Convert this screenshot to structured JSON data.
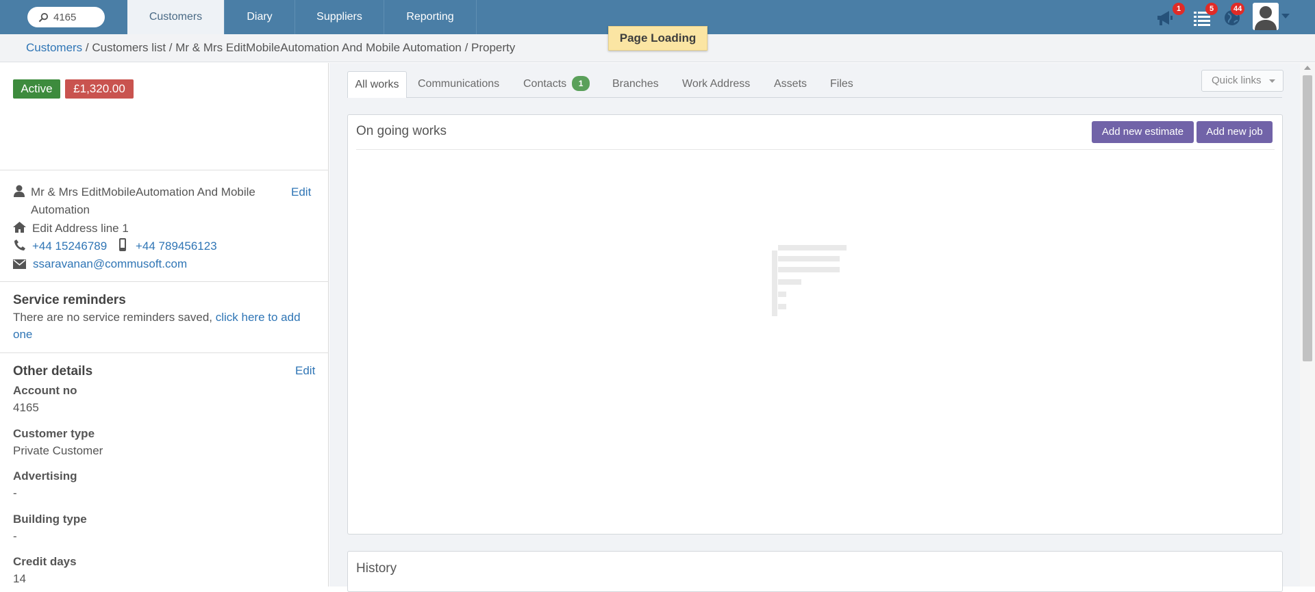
{
  "search": {
    "value": "4165"
  },
  "nav": {
    "tabs": [
      {
        "label": "Customers",
        "active": true
      },
      {
        "label": "Diary"
      },
      {
        "label": "Suppliers"
      },
      {
        "label": "Reporting"
      }
    ]
  },
  "notifications": {
    "announcements": "1",
    "tasks": "5",
    "online": "44"
  },
  "breadcrumb": {
    "root": "Customers",
    "rest": " / Customers list / Mr & Mrs EditMobileAutomation And Mobile Automation / Property"
  },
  "loading_toast": "Page Loading",
  "customer": {
    "status": "Active",
    "balance": "£1,320.00",
    "name_line1": "Mr & Mrs EditMobileAutomation And Mobile",
    "name_line2": "Automation",
    "edit_label": "Edit",
    "address": "Edit Address line 1",
    "phone": "+44 15246789",
    "mobile": "+44 789456123",
    "email": "ssaravanan@commusoft.com"
  },
  "service_reminders": {
    "title": "Service reminders",
    "text": "There are no service reminders saved, ",
    "link_part1": "click here to add",
    "link_part2": "one"
  },
  "other_details": {
    "title": "Other details",
    "edit_label": "Edit",
    "fields": [
      {
        "label": "Account no",
        "value": "4165"
      },
      {
        "label": "Customer type",
        "value": "Private Customer"
      },
      {
        "label": "Advertising",
        "value": "-"
      },
      {
        "label": "Building type",
        "value": "-"
      },
      {
        "label": "Credit days",
        "value": "14"
      }
    ]
  },
  "tabs": {
    "items": [
      {
        "label": "All works",
        "active": true
      },
      {
        "label": "Communications"
      },
      {
        "label": "Contacts",
        "badge": "1"
      },
      {
        "label": "Branches"
      },
      {
        "label": "Work Address"
      },
      {
        "label": "Assets"
      },
      {
        "label": "Files"
      }
    ],
    "quick_links": "Quick links"
  },
  "ongoing": {
    "title": "On going works",
    "add_estimate": "Add new estimate",
    "add_job": "Add new job"
  },
  "history": {
    "title": "History"
  },
  "colors": {
    "topbar": "#4a7ea6",
    "active_green": "#3d8b3d",
    "balance_red": "#c9534f",
    "purple_button": "#7163a8",
    "badge_red": "#e02b27",
    "link_blue": "#2f75b5"
  }
}
